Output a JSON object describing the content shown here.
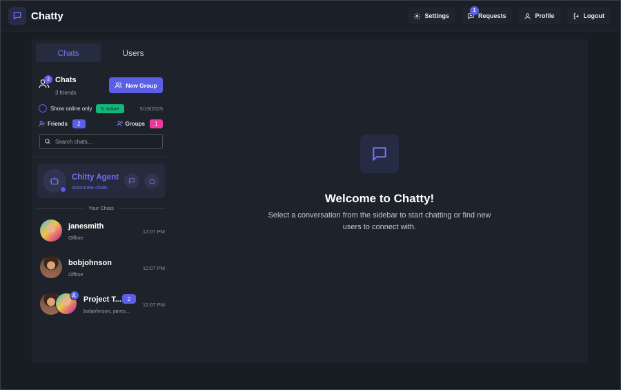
{
  "header": {
    "app_name": "Chatty",
    "nav": [
      {
        "label": "Settings",
        "icon": "gear-icon"
      },
      {
        "label": "Requests",
        "icon": "message-plus-icon",
        "badge": "1"
      },
      {
        "label": "Profile",
        "icon": "user-icon"
      },
      {
        "label": "Logout",
        "icon": "logout-icon"
      }
    ]
  },
  "sidebar": {
    "tabs": [
      {
        "label": "Chats",
        "active": true
      },
      {
        "label": "Users",
        "active": false
      }
    ],
    "chats_header": {
      "title": "Chats",
      "subtitle": "3 friends",
      "badge": "3",
      "new_group_label": "New Group"
    },
    "online_filter": {
      "label": "Show online only",
      "online_count": "0 online",
      "date": "5/19/2025"
    },
    "friends": {
      "label": "Friends",
      "count": "2"
    },
    "groups": {
      "label": "Groups",
      "count": "1"
    },
    "search": {
      "placeholder": "Search chats..."
    },
    "agent": {
      "name": "Chitty Agent",
      "subtitle": "Automate chats"
    },
    "section_label": "Your Chats",
    "chats": [
      {
        "name": "janesmith",
        "status": "Offline",
        "time": "12:07 PM"
      },
      {
        "name": "bobjohnson",
        "status": "Offline",
        "time": "12:07 PM"
      }
    ],
    "group_chat": {
      "name": "Project T...",
      "unread": "2",
      "members": "bobjohnson, janes...",
      "time": "12:07 PM"
    }
  },
  "main": {
    "title": "Welcome to Chatty!",
    "text": "Select a conversation from the sidebar to start chatting or find new users to connect with."
  },
  "colors": {
    "accent": "#5b5fe8",
    "online_green": "#13b77a",
    "group_pink": "#e83c9c",
    "background": "#181d24",
    "panel": "#1e232b"
  }
}
